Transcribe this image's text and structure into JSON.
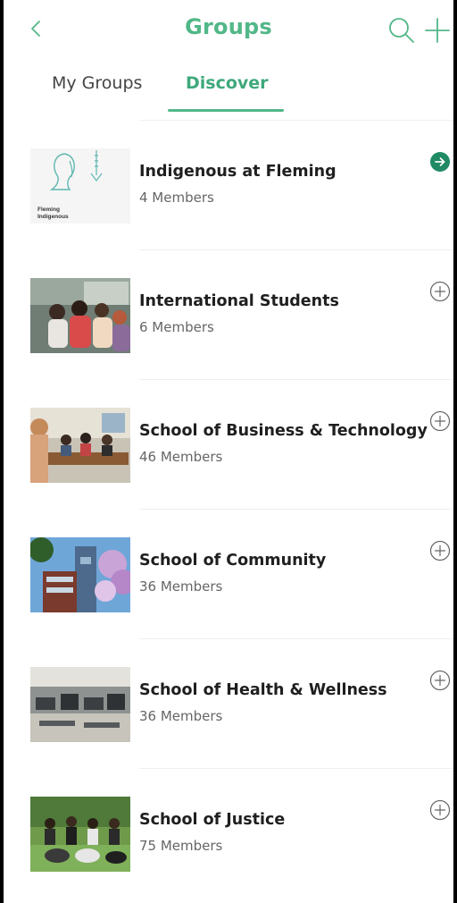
{
  "header": {
    "title": "Groups",
    "back_icon": "chevron-left-icon",
    "search_icon": "search-icon",
    "add_icon": "plus-icon",
    "accent_color": "#52b788"
  },
  "tabs": [
    {
      "label": "My Groups",
      "active": false
    },
    {
      "label": "Discover",
      "active": true
    }
  ],
  "groups": [
    {
      "name": "Indigenous at Fleming",
      "members": "4 Members",
      "action_icon": "arrow-right-circle-icon",
      "joined": true,
      "thumb_caption_line1": "Fleming",
      "thumb_caption_line2": "Indigenous"
    },
    {
      "name": "International Students",
      "members": "6 Members",
      "action_icon": "plus-circle-icon",
      "joined": false
    },
    {
      "name": "School of Business & Technology",
      "members": "46 Members",
      "action_icon": "plus-circle-icon",
      "joined": false
    },
    {
      "name": "School of Community",
      "members": "36 Members",
      "action_icon": "plus-circle-icon",
      "joined": false
    },
    {
      "name": "School of Health & Wellness",
      "members": "36 Members",
      "action_icon": "plus-circle-icon",
      "joined": false
    },
    {
      "name": "School of Justice",
      "members": "75 Members",
      "action_icon": "plus-circle-icon",
      "joined": false
    }
  ]
}
